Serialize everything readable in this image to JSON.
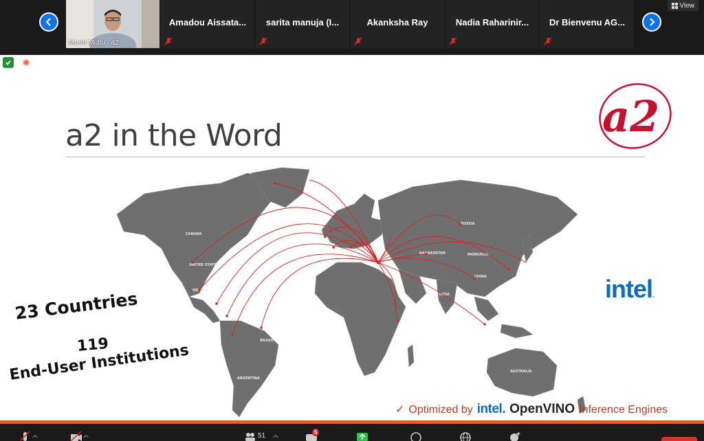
{
  "participants_strip": {
    "video_participant": {
      "label": "Murat Mutlu - a2"
    },
    "tiles": [
      {
        "name": "Amadou  Aissata..."
      },
      {
        "name": "sarita manuja (I..."
      },
      {
        "name": "Akanksha Ray"
      },
      {
        "name": "Nadia  Raharinir..."
      },
      {
        "name": "Dr Bienvenu AG..."
      }
    ],
    "view_button": "View"
  },
  "slide": {
    "title": "a2 in the Word",
    "stats": {
      "countries": "23 Countries",
      "institutions_count": "119",
      "institutions_label": "End-User Institutions"
    },
    "optimized": {
      "check": "✓",
      "prefix": "Optimized by",
      "brand_intel": "intel.",
      "brand_openvino": "OpenVINO",
      "suffix": "Inference Engines"
    },
    "intel_logo": "intel",
    "logo_text": "a2",
    "map_labels": {
      "canada": "CANADA",
      "usa": "UNITED STATES",
      "mexico": "MEXICO",
      "brazil": "BRAZIL",
      "argentina": "ARGENTINA",
      "russia": "RUSSIA",
      "kazakhstan": "KAZAKHSTAN",
      "mongolia": "MONGOLIA",
      "china": "CHINA",
      "india": "INDIA",
      "australia": "AUSTRALIA"
    }
  },
  "toolbar": {
    "participants_count": "51",
    "chat_badge": "5"
  },
  "colors": {
    "accent_blue": "#0e72ed",
    "brand_red": "#c8102e",
    "intel_blue": "#0a6ebd",
    "slide_bar": "#e2611e",
    "map_gray": "#6f6f6f"
  }
}
